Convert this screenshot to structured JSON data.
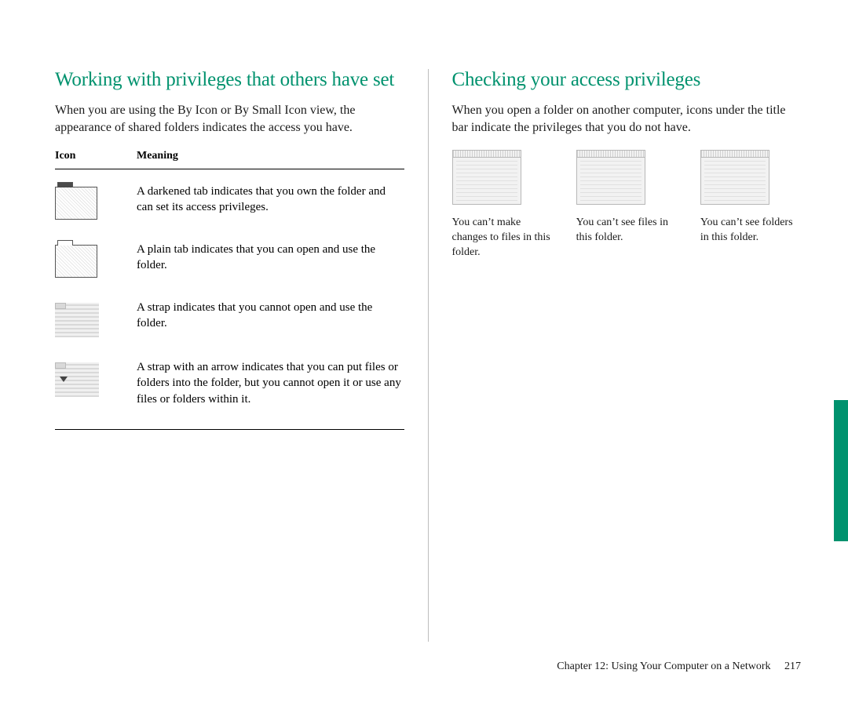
{
  "left": {
    "heading": "Working with privileges that others have set",
    "intro": "When you are using the By Icon or By Small Icon view, the appearance of shared folders indicates the access you have.",
    "table": {
      "head_icon": "Icon",
      "head_meaning": "Meaning",
      "rows": [
        {
          "icon": "folder-dark-tab",
          "meaning": "A darkened tab indicates that you own the folder and can set its access privileges."
        },
        {
          "icon": "folder-plain-tab",
          "meaning": "A plain tab indicates that you can open and use the folder."
        },
        {
          "icon": "folder-strap",
          "meaning": "A strap indicates that you cannot open and use the folder."
        },
        {
          "icon": "folder-strap-arrow",
          "meaning": "A strap with an arrow indicates that you can put files or folders into the folder, but you cannot open it or use any files or folders within it."
        }
      ]
    }
  },
  "right": {
    "heading": "Checking your access privileges",
    "intro": "When you open a folder on another computer, icons under the title bar indicate the privileges that you do not have.",
    "items": [
      {
        "icon": "window-no-changes",
        "caption": "You can’t make changes to files in this folder."
      },
      {
        "icon": "window-no-files",
        "caption": "You can’t see files in this folder."
      },
      {
        "icon": "window-no-folders",
        "caption": "You can’t see folders in this folder."
      }
    ]
  },
  "footer": {
    "chapter": "Chapter 12: Using Your Computer on a Network",
    "page": "217"
  },
  "colors": {
    "accent": "#00926e"
  }
}
